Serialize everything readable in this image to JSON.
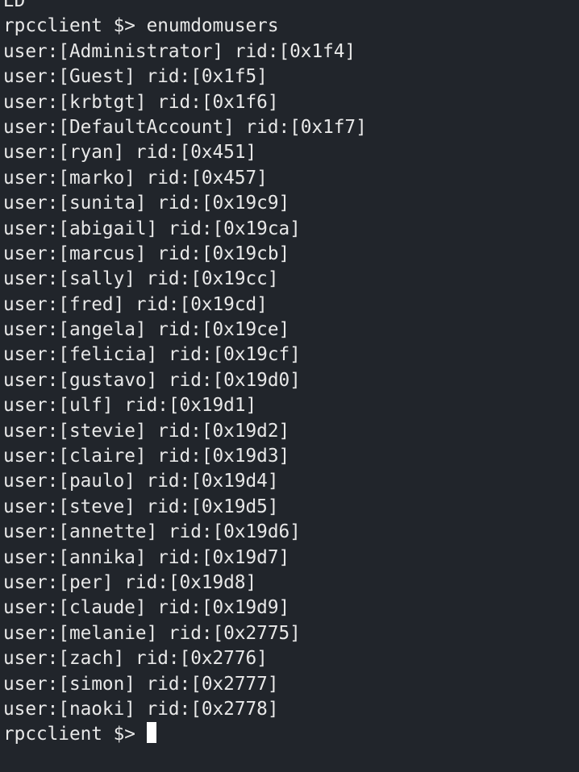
{
  "terminal": {
    "top_partial_line": "ED",
    "prompt": "rpcclient $>",
    "command": "enumdomusers",
    "output_lines": [
      "user:[Administrator] rid:[0x1f4]",
      "user:[Guest] rid:[0x1f5]",
      "user:[krbtgt] rid:[0x1f6]",
      "user:[DefaultAccount] rid:[0x1f7]",
      "user:[ryan] rid:[0x451]",
      "user:[marko] rid:[0x457]",
      "user:[sunita] rid:[0x19c9]",
      "user:[abigail] rid:[0x19ca]",
      "user:[marcus] rid:[0x19cb]",
      "user:[sally] rid:[0x19cc]",
      "user:[fred] rid:[0x19cd]",
      "user:[angela] rid:[0x19ce]",
      "user:[felicia] rid:[0x19cf]",
      "user:[gustavo] rid:[0x19d0]",
      "user:[ulf] rid:[0x19d1]",
      "user:[stevie] rid:[0x19d2]",
      "user:[claire] rid:[0x19d3]",
      "user:[paulo] rid:[0x19d4]",
      "user:[steve] rid:[0x19d5]",
      "user:[annette] rid:[0x19d6]",
      "user:[annika] rid:[0x19d7]",
      "user:[per] rid:[0x19d8]",
      "user:[claude] rid:[0x19d9]",
      "user:[melanie] rid:[0x2775]",
      "user:[zach] rid:[0x2776]",
      "user:[simon] rid:[0x2777]",
      "user:[naoki] rid:[0x2778]"
    ],
    "final_prompt": "rpcclient $>",
    "colors": {
      "background": "#21252b",
      "foreground": "#e8e8e8",
      "cursor": "#ffffff"
    }
  }
}
